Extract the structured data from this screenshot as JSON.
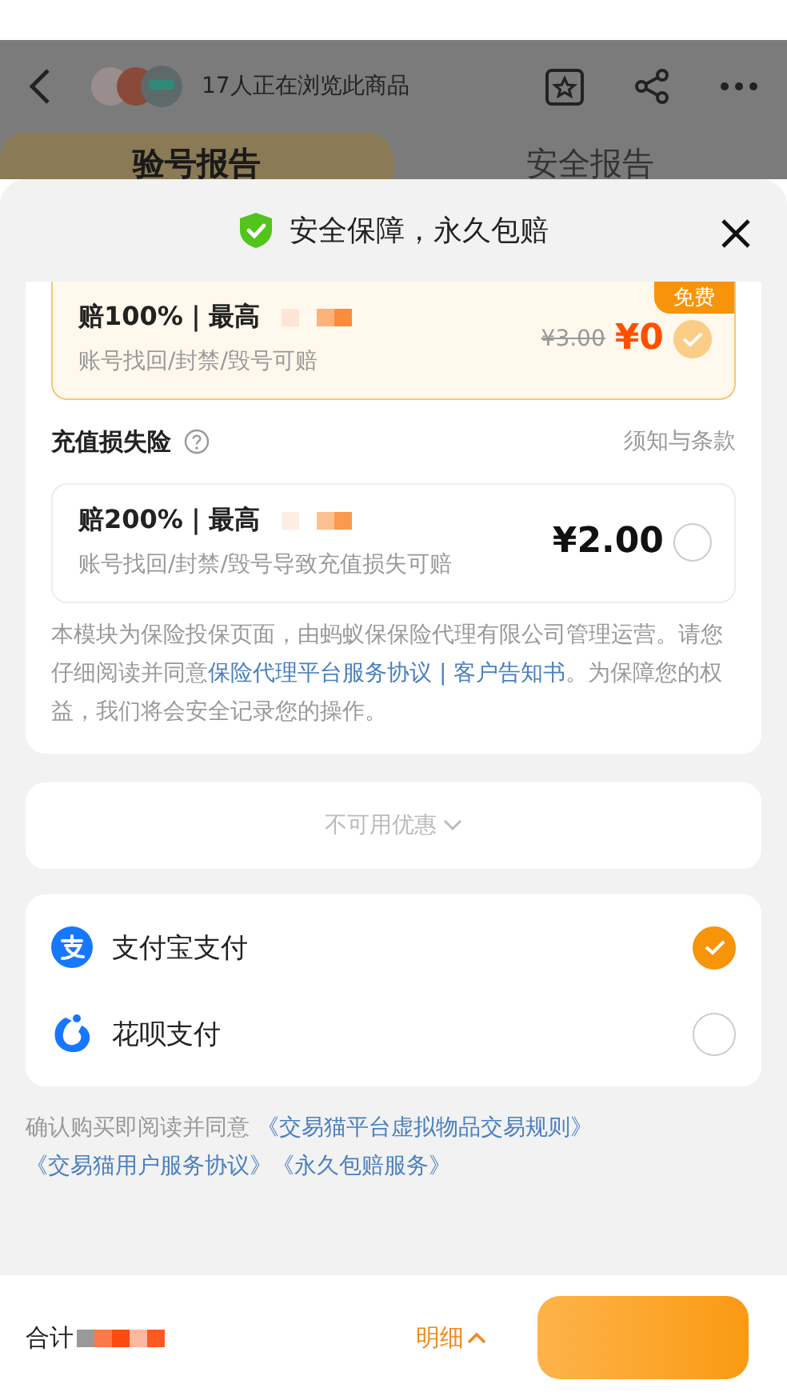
{
  "header": {
    "viewers": "17人正在浏览此商品"
  },
  "tabs": [
    {
      "label": "验号报告",
      "selected": true
    },
    {
      "label": "安全报告",
      "selected": false
    }
  ],
  "sheet": {
    "title": "安全保障，永久包赔",
    "sections": [
      {
        "option": {
          "title": "赔100%｜最高",
          "desc": "账号找回/封禁/毁号可赔",
          "original_price": "¥3.00",
          "price": "¥0",
          "badge": "免费",
          "selected": true,
          "highlighted": true
        }
      },
      {
        "heading": "充值损失险",
        "terms": "须知与条款",
        "option": {
          "title": "赔200%｜最高",
          "desc": "账号找回/封禁/毁号导致充值损失可赔",
          "price": "¥2.00",
          "selected": false,
          "highlighted": false
        }
      }
    ],
    "notice": [
      {
        "kind": "text",
        "text": "本模块为保险投保页面，由蚂蚁保保险代理有限公司管理运营。请您仔细阅读并同意"
      },
      {
        "kind": "link",
        "text": "保险代理平台服务协议"
      },
      {
        "kind": "sep",
        "text": " | "
      },
      {
        "kind": "link",
        "text": "客户告知书"
      },
      {
        "kind": "text",
        "text": "。为保障您的权益，我们将会安全记录您的操作。"
      }
    ],
    "coupon": "不可用优惠",
    "payments": [
      {
        "name": "支付宝支付",
        "kind": "alipay",
        "selected": true
      },
      {
        "name": "花呗支付",
        "kind": "huabei",
        "selected": false
      }
    ],
    "agreement": [
      {
        "kind": "text",
        "text": "确认购买即阅读并同意 "
      },
      {
        "kind": "link",
        "text": "《交易猫平台虚拟物品交易规则》"
      },
      {
        "kind": "link",
        "text": "《交易猫用户服务协议》"
      },
      {
        "kind": "link",
        "text": "《永久包赔服务》"
      }
    ]
  },
  "footer": {
    "total_label": "合计",
    "detail": "明细"
  }
}
